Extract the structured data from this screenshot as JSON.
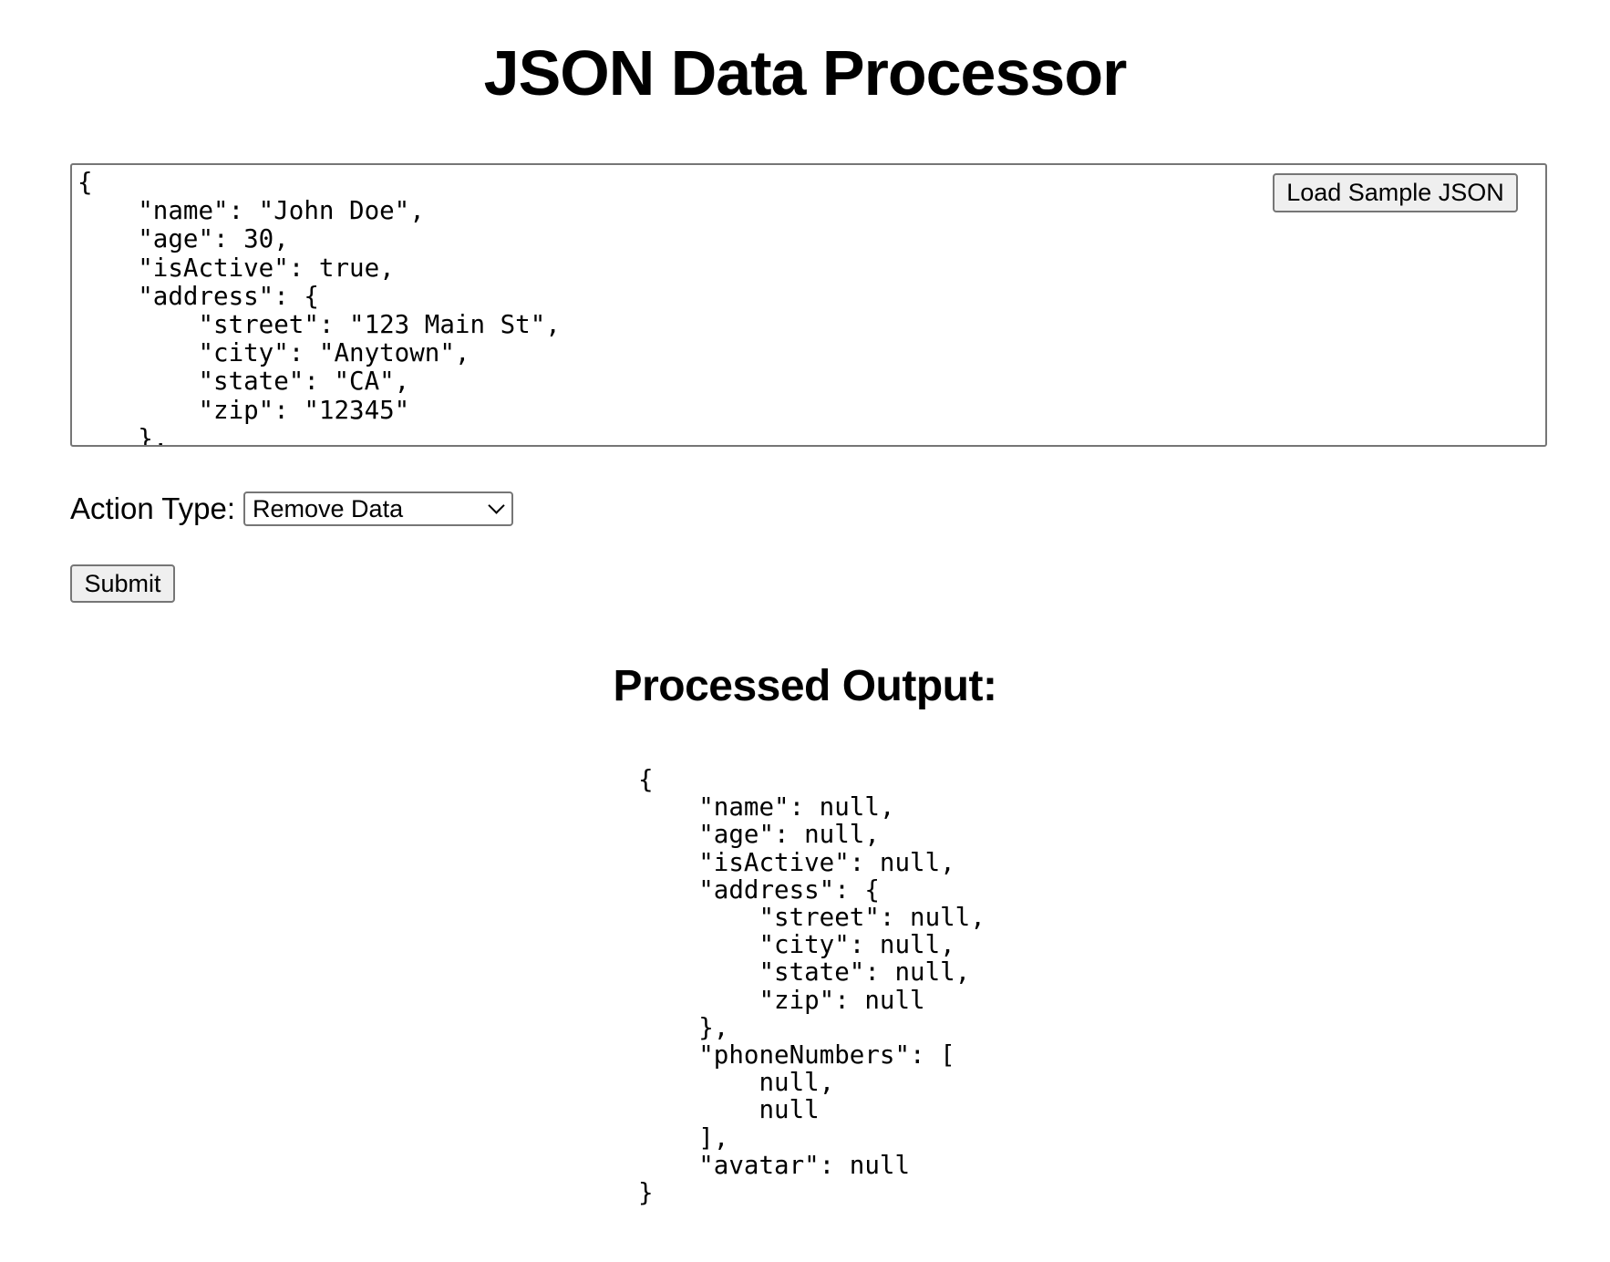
{
  "page": {
    "title": "JSON Data Processor"
  },
  "editor": {
    "value": "{\n    \"name\": \"John Doe\",\n    \"age\": 30,\n    \"isActive\": true,\n    \"address\": {\n        \"street\": \"123 Main St\",\n        \"city\": \"Anytown\",\n        \"state\": \"CA\",\n        \"zip\": \"12345\"\n    },",
    "load_sample_label": "Load Sample JSON"
  },
  "action": {
    "label": "Action Type:",
    "selected": "Remove Data",
    "icon": "chevron-down-icon"
  },
  "submit": {
    "label": "Submit"
  },
  "output": {
    "heading": "Processed Output:",
    "content": "{\n    \"name\": null,\n    \"age\": null,\n    \"isActive\": null,\n    \"address\": {\n        \"street\": null,\n        \"city\": null,\n        \"state\": null,\n        \"zip\": null\n    },\n    \"phoneNumbers\": [\n        null,\n        null\n    ],\n    \"avatar\": null\n}"
  },
  "colors": {
    "text": "#000000",
    "background": "#ffffff",
    "button_bg": "#efefef",
    "border": "#767676"
  }
}
